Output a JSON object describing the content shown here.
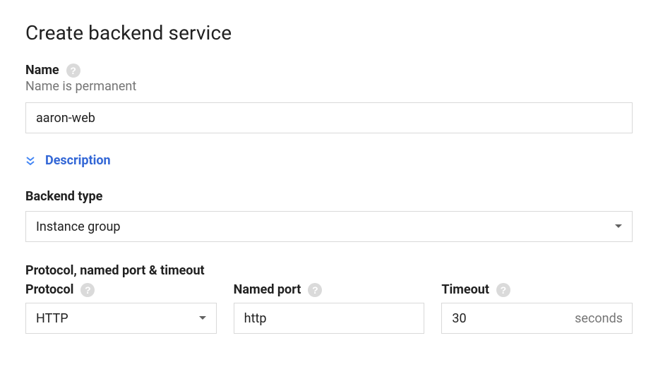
{
  "title": "Create backend service",
  "name": {
    "label": "Name",
    "subtext": "Name is permanent",
    "value": "aaron-web"
  },
  "description": {
    "label": "Description"
  },
  "backend_type": {
    "label": "Backend type",
    "value": "Instance group"
  },
  "protocols_heading": "Protocol, named port & timeout",
  "protocol": {
    "label": "Protocol",
    "value": "HTTP"
  },
  "named_port": {
    "label": "Named port",
    "value": "http"
  },
  "timeout": {
    "label": "Timeout",
    "value": "30",
    "suffix": "seconds"
  }
}
